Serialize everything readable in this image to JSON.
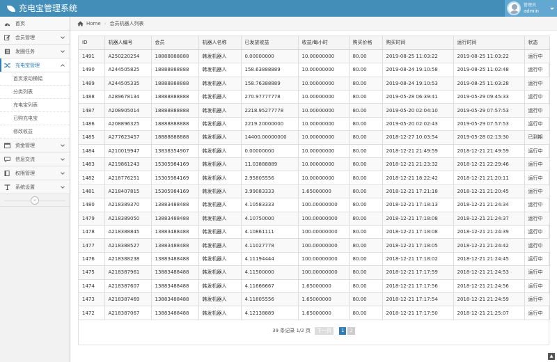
{
  "header": {
    "title": "充电宝管理系统",
    "user_role": "管理员",
    "user_name": "admin"
  },
  "sidebar": {
    "items": [
      {
        "label": "首页",
        "icon": "dashboard-icon"
      },
      {
        "label": "会员管理",
        "icon": "edit-icon"
      },
      {
        "label": "发圈任务",
        "icon": "list-icon"
      },
      {
        "label": "充电宝管理",
        "icon": "shuffle-icon"
      }
    ],
    "sub_items": [
      "首页滚动横幅",
      "分类列表",
      "充电宝列表",
      "已购充电宝",
      "修改收益"
    ],
    "items2": [
      {
        "label": "资金管理",
        "icon": "calendar-icon"
      },
      {
        "label": "信息交流",
        "icon": "message-icon"
      },
      {
        "label": "权限管理",
        "icon": "book-icon"
      },
      {
        "label": "系统设置",
        "icon": "text-icon"
      }
    ],
    "collapse": "«"
  },
  "breadcrumb": {
    "home": "Home",
    "current": "会员机器人列表"
  },
  "table": {
    "headers": [
      "ID",
      "机器人编号",
      "会员",
      "机器人名称",
      "已发放收益",
      "收益/每小时",
      "购买价格",
      "购买时间",
      "运行时间",
      "状态"
    ],
    "rows": [
      [
        "1491",
        "A250220254",
        "18888888888",
        "韩发机器人",
        "0.00000000",
        "10.00000000",
        "80.00",
        "2019-08-25 11:03:22",
        "2019-08-25 11:03:22",
        "运行中"
      ],
      [
        "1490",
        "A244505825",
        "18888888888",
        "韩发机器人",
        "158.63888889",
        "10.00000000",
        "80.00",
        "2019-08-24 19:10:58",
        "2019-08-25 11:02:48",
        "运行中"
      ],
      [
        "1489",
        "A244505335",
        "18888888888",
        "韩发机器人",
        "158.76388889",
        "10.00000000",
        "80.00",
        "2019-08-24 19:10:53",
        "2019-08-25 11:03:28",
        "运行中"
      ],
      [
        "1488",
        "A289678134",
        "18888888888",
        "韩发机器人",
        "270.97777778",
        "10.00000000",
        "80.00",
        "2019-05-28 06:39:41",
        "2019-05-29 09:45:33",
        "运行中"
      ],
      [
        "1487",
        "A208905014",
        "18888888888",
        "韩发机器人",
        "2218.95277778",
        "10.00000000",
        "80.00",
        "2019-05-20 02:04:10",
        "2019-05-29 07:57:53",
        "运行中"
      ],
      [
        "1486",
        "A208896325",
        "18888888888",
        "韩发机器人",
        "2219.20000000",
        "10.00000000",
        "80.00",
        "2019-05-20 02:02:43",
        "2019-05-29 07:57:53",
        "运行中"
      ],
      [
        "1485",
        "A277623457",
        "18888888888",
        "韩发机器人",
        "14400.00000000",
        "10.00000000",
        "80.00",
        "2018-12-27 10:03:54",
        "2019-05-28 02:13:30",
        "已到期"
      ],
      [
        "1484",
        "A210019947",
        "13838354907",
        "韩发机器人",
        "0.00000000",
        "10.00000000",
        "80.00",
        "2018-12-21 21:49:59",
        "2018-12-21 21:49:59",
        "运行中"
      ],
      [
        "1483",
        "A219861243",
        "15305984169",
        "韩发机器人",
        "11.03888889",
        "10.00000000",
        "80.00",
        "2018-12-21 21:23:32",
        "2018-12-21 22:29:46",
        "运行中"
      ],
      [
        "1482",
        "A218776251",
        "15305984169",
        "韩发机器人",
        "2.95805556",
        "10.00000000",
        "80.00",
        "2018-12-21 18:22:42",
        "2018-12-21 21:20:11",
        "运行中"
      ],
      [
        "1481",
        "A218407815",
        "15305984169",
        "韩发机器人",
        "3.99083333",
        "1.65000000",
        "80.00",
        "2018-12-21 17:21:18",
        "2018-12-21 21:20:45",
        "运行中"
      ],
      [
        "1480",
        "A218389370",
        "13883488488",
        "韩发机器人",
        "4.10583333",
        "100.00000000",
        "80.00",
        "2018-12-21 17:18:13",
        "2018-12-21 21:24:34",
        "运行中"
      ],
      [
        "1479",
        "A218389050",
        "13883488488",
        "韩发机器人",
        "4.10750000",
        "100.00000000",
        "80.00",
        "2018-12-21 17:18:08",
        "2018-12-21 21:24:37",
        "运行中"
      ],
      [
        "1478",
        "A218388845",
        "13883488488",
        "韩发机器人",
        "4.10861111",
        "100.00000000",
        "80.00",
        "2018-12-21 17:18:08",
        "2018-12-21 21:24:39",
        "运行中"
      ],
      [
        "1477",
        "A218388527",
        "13883488488",
        "韩发机器人",
        "4.11027778",
        "100.00000000",
        "80.00",
        "2018-12-21 17:18:05",
        "2018-12-21 21:24:42",
        "运行中"
      ],
      [
        "1476",
        "A218388238",
        "13883488488",
        "韩发机器人",
        "4.11194444",
        "100.00000000",
        "80.00",
        "2018-12-21 17:18:02",
        "2018-12-21 21:24:45",
        "运行中"
      ],
      [
        "1475",
        "A218387961",
        "13883488488",
        "韩发机器人",
        "4.11500000",
        "100.00000000",
        "80.00",
        "2018-12-21 17:17:59",
        "2018-12-21 21:24:53",
        "运行中"
      ],
      [
        "1474",
        "A218387607",
        "13883488488",
        "韩发机器人",
        "4.11666667",
        "1.65000000",
        "80.00",
        "2018-12-21 17:17:56",
        "2018-12-21 21:24:56",
        "运行中"
      ],
      [
        "1473",
        "A218387469",
        "13883488488",
        "韩发机器人",
        "4.11805556",
        "1.65000000",
        "80.00",
        "2018-12-21 17:17:54",
        "2018-12-21 21:24:59",
        "运行中"
      ],
      [
        "1472",
        "A218387067",
        "13883488488",
        "韩发机器人",
        "4.12138889",
        "1.65000000",
        "80.00",
        "2018-12-21 17:17:50",
        "2018-12-21 21:25:07",
        "运行中"
      ]
    ]
  },
  "pagination": {
    "summary": "39 条记录 1/2 页",
    "next": "下一页",
    "current": "1",
    "page2": "2"
  },
  "scroll_top": "▲"
}
